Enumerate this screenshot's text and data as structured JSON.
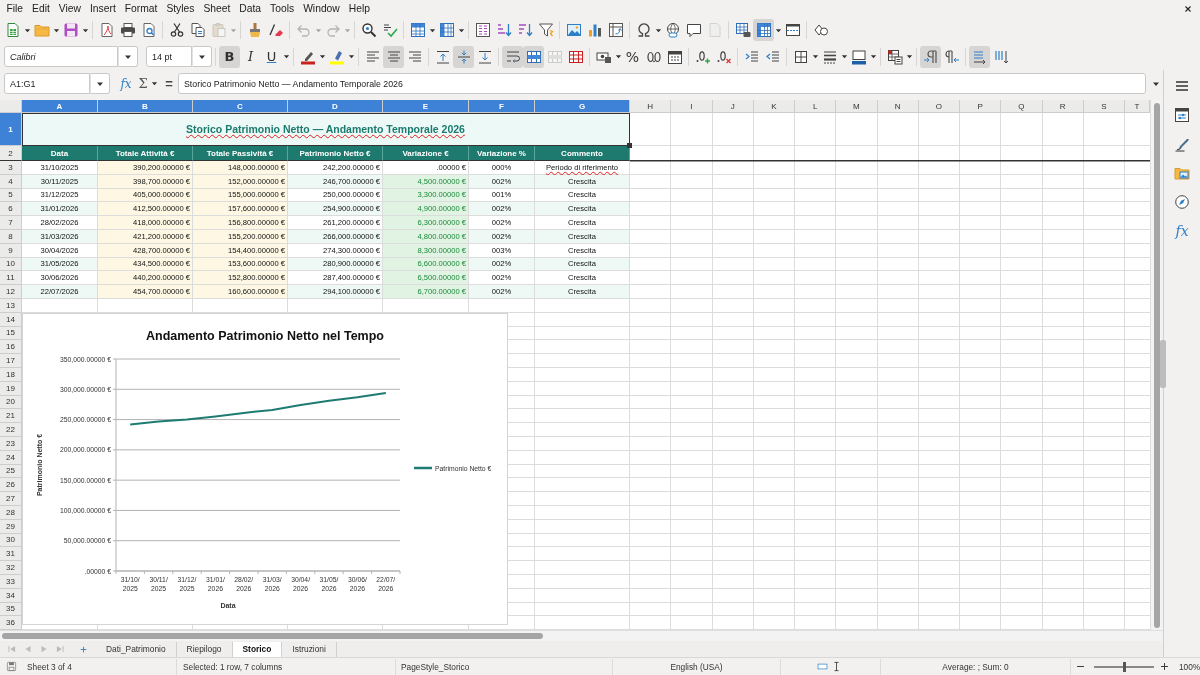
{
  "menu_bar": {
    "items": [
      "File",
      "Edit",
      "View",
      "Insert",
      "Format",
      "Styles",
      "Sheet",
      "Data",
      "Tools",
      "Window",
      "Help"
    ]
  },
  "standard_toolbar": {
    "tools": [
      {
        "pressed": false,
        "disabled": false
      },
      {
        "pressed": false,
        "disabled": false
      },
      {
        "pressed": false,
        "disabled": false
      },
      {
        "pressed": false,
        "disabled": false
      },
      {
        "pressed": false,
        "disabled": false
      },
      {
        "pressed": false,
        "disabled": false
      },
      {
        "pressed": false,
        "disabled": false
      },
      {
        "pressed": false,
        "disabled": false
      },
      {
        "pressed": false,
        "disabled": true
      },
      {
        "pressed": false,
        "disabled": false
      },
      {
        "pressed": false,
        "disabled": false
      },
      {
        "pressed": false,
        "disabled": true
      },
      {
        "pressed": false,
        "disabled": true
      },
      {
        "pressed": false,
        "disabled": false
      },
      {
        "pressed": false,
        "disabled": false
      },
      {
        "pressed": false,
        "disabled": false
      },
      {
        "pressed": false,
        "disabled": false
      },
      {
        "pressed": false,
        "disabled": false
      },
      {
        "pressed": false,
        "disabled": false
      },
      {
        "pressed": false,
        "disabled": false
      },
      {
        "pressed": false,
        "disabled": false
      },
      {
        "pressed": false,
        "disabled": false
      },
      {
        "pressed": false,
        "disabled": false
      },
      {
        "pressed": false,
        "disabled": false
      },
      {
        "pressed": false,
        "disabled": false
      },
      {
        "pressed": false,
        "disabled": false
      },
      {
        "pressed": false,
        "disabled": false
      },
      {
        "pressed": false,
        "disabled": true
      },
      {
        "pressed": false,
        "disabled": false
      },
      {
        "pressed": true,
        "disabled": false
      },
      {
        "pressed": false,
        "disabled": false
      },
      {
        "pressed": false,
        "disabled": false
      }
    ]
  },
  "formatting_toolbar": {
    "font_name": "Calibri",
    "font_size": "14 pt",
    "tools": [
      {
        "label": "B",
        "pressed": true,
        "disabled": false
      },
      {
        "label": "I",
        "pressed": false,
        "disabled": false
      },
      {
        "label": "U",
        "pressed": false,
        "disabled": false
      },
      {
        "pressed": false,
        "disabled": false
      },
      {
        "pressed": false,
        "disabled": false
      },
      {
        "pressed": false,
        "disabled": false
      },
      {
        "pressed": true,
        "disabled": false
      },
      {
        "pressed": false,
        "disabled": false
      },
      {
        "pressed": false,
        "disabled": false
      },
      {
        "pressed": true,
        "disabled": false
      },
      {
        "pressed": false,
        "disabled": false
      },
      {
        "pressed": true,
        "disabled": false
      },
      {
        "pressed": true,
        "disabled": false
      },
      {
        "pressed": false,
        "disabled": true
      },
      {
        "pressed": false,
        "disabled": false
      },
      {
        "pressed": false,
        "disabled": false
      },
      {
        "label": "%",
        "pressed": false,
        "disabled": false
      },
      {
        "pressed": false,
        "disabled": false
      },
      {
        "pressed": false,
        "disabled": false
      },
      {
        "pressed": false,
        "disabled": false
      },
      {
        "pressed": false,
        "disabled": false
      },
      {
        "pressed": false,
        "disabled": false
      },
      {
        "pressed": false,
        "disabled": false
      },
      {
        "pressed": false,
        "disabled": false
      },
      {
        "pressed": false,
        "disabled": false
      },
      {
        "pressed": false,
        "disabled": false
      },
      {
        "pressed": false,
        "disabled": false
      },
      {
        "pressed": true,
        "disabled": false
      },
      {
        "pressed": false,
        "disabled": false
      },
      {
        "pressed": true,
        "disabled": false
      },
      {
        "pressed": false,
        "disabled": false
      }
    ]
  },
  "formula_bar": {
    "name_box": "A1:G1",
    "function_wizard": "fx",
    "sum": "Σ",
    "formula": "=",
    "content": "Storico Patrimonio Netto — Andamento Temporale 2026"
  },
  "sidebar": {
    "functions": "fx"
  },
  "sheet": {
    "columns": [
      {
        "label": "A",
        "selected": true
      },
      {
        "label": "B",
        "selected": true
      },
      {
        "label": "C",
        "selected": true
      },
      {
        "label": "D",
        "selected": true
      },
      {
        "label": "E",
        "selected": true
      },
      {
        "label": "F",
        "selected": true
      },
      {
        "label": "G",
        "selected": true
      },
      {
        "label": "H",
        "selected": false
      },
      {
        "label": "I",
        "selected": false
      },
      {
        "label": "J",
        "selected": false
      },
      {
        "label": "K",
        "selected": false
      },
      {
        "label": "L",
        "selected": false
      },
      {
        "label": "M",
        "selected": false
      },
      {
        "label": "N",
        "selected": false
      },
      {
        "label": "O",
        "selected": false
      },
      {
        "label": "P",
        "selected": false
      },
      {
        "label": "Q",
        "selected": false
      },
      {
        "label": "R",
        "selected": false
      },
      {
        "label": "S",
        "selected": false
      },
      {
        "label": "T",
        "selected": false
      }
    ],
    "rows": [
      {
        "label": "1",
        "selected": true
      },
      {
        "label": "2",
        "selected": false
      },
      {
        "label": "3",
        "selected": false
      },
      {
        "label": "4",
        "selected": false
      },
      {
        "label": "5",
        "selected": false
      },
      {
        "label": "6",
        "selected": false
      },
      {
        "label": "7",
        "selected": false
      },
      {
        "label": "8",
        "selected": false
      },
      {
        "label": "9",
        "selected": false
      },
      {
        "label": "10",
        "selected": false
      },
      {
        "label": "11",
        "selected": false
      },
      {
        "label": "12",
        "selected": false
      },
      {
        "label": "13",
        "selected": false
      },
      {
        "label": "14",
        "selected": false
      },
      {
        "label": "15",
        "selected": false
      },
      {
        "label": "16",
        "selected": false
      },
      {
        "label": "17",
        "selected": false
      },
      {
        "label": "18",
        "selected": false
      },
      {
        "label": "19",
        "selected": false
      },
      {
        "label": "20",
        "selected": false
      },
      {
        "label": "21",
        "selected": false
      },
      {
        "label": "22",
        "selected": false
      },
      {
        "label": "23",
        "selected": false
      },
      {
        "label": "24",
        "selected": false
      },
      {
        "label": "25",
        "selected": false
      },
      {
        "label": "26",
        "selected": false
      },
      {
        "label": "27",
        "selected": false
      },
      {
        "label": "28",
        "selected": false
      },
      {
        "label": "29",
        "selected": false
      },
      {
        "label": "30",
        "selected": false
      },
      {
        "label": "31",
        "selected": false
      },
      {
        "label": "32",
        "selected": false
      },
      {
        "label": "33",
        "selected": false
      },
      {
        "label": "34",
        "selected": false
      },
      {
        "label": "35",
        "selected": false
      },
      {
        "label": "36",
        "selected": false
      }
    ],
    "title": {
      "text": "Storico Patrimonio Netto — Andamento Temporale 2026",
      "selected": true,
      "misspelled": true
    },
    "headers": [
      "Data",
      "Totale Attività €",
      "Totale Passività €",
      "Patrimonio Netto €",
      "Variazione €",
      "Variazione %",
      "Commento"
    ],
    "records": [
      {
        "cells": [
          "31/10/2025",
          "390,200.00000 €",
          "148,000.00000 €",
          "242,200.00000 €",
          ".00000 €",
          "000%",
          "Periodo di riferimento"
        ],
        "positive": false,
        "comment_misspelled": true
      },
      {
        "cells": [
          "30/11/2025",
          "398,700.00000 €",
          "152,000.00000 €",
          "246,700.00000 €",
          "4,500.00000 €",
          "002%",
          "Crescita"
        ],
        "positive": true,
        "comment_misspelled": false
      },
      {
        "cells": [
          "31/12/2025",
          "405,000.00000 €",
          "155,000.00000 €",
          "250,000.00000 €",
          "3,300.00000 €",
          "001%",
          "Crescita"
        ],
        "positive": true,
        "comment_misspelled": false
      },
      {
        "cells": [
          "31/01/2026",
          "412,500.00000 €",
          "157,600.00000 €",
          "254,900.00000 €",
          "4,900.00000 €",
          "002%",
          "Crescita"
        ],
        "positive": true,
        "comment_misspelled": false
      },
      {
        "cells": [
          "28/02/2026",
          "418,000.00000 €",
          "156,800.00000 €",
          "261,200.00000 €",
          "6,300.00000 €",
          "002%",
          "Crescita"
        ],
        "positive": true,
        "comment_misspelled": false
      },
      {
        "cells": [
          "31/03/2026",
          "421,200.00000 €",
          "155,200.00000 €",
          "266,000.00000 €",
          "4,800.00000 €",
          "002%",
          "Crescita"
        ],
        "positive": true,
        "comment_misspelled": false
      },
      {
        "cells": [
          "30/04/2026",
          "428,700.00000 €",
          "154,400.00000 €",
          "274,300.00000 €",
          "8,300.00000 €",
          "003%",
          "Crescita"
        ],
        "positive": true,
        "comment_misspelled": false
      },
      {
        "cells": [
          "31/05/2026",
          "434,500.00000 €",
          "153,600.00000 €",
          "280,900.00000 €",
          "6,600.00000 €",
          "002%",
          "Crescita"
        ],
        "positive": true,
        "comment_misspelled": false
      },
      {
        "cells": [
          "30/06/2026",
          "440,200.00000 €",
          "152,800.00000 €",
          "287,400.00000 €",
          "6,500.00000 €",
          "002%",
          "Crescita"
        ],
        "positive": true,
        "comment_misspelled": false
      },
      {
        "cells": [
          "22/07/2026",
          "454,700.00000 €",
          "160,600.00000 €",
          "294,100.00000 €",
          "6,700.00000 €",
          "002%",
          "Crescita"
        ],
        "positive": true,
        "comment_misspelled": false
      }
    ],
    "chart": {
      "chart_data": {
        "type": "line",
        "title": "Andamento Patrimonio Netto nel Tempo",
        "xlabel": "Data",
        "ylabel": "Patrimonio Netto €",
        "categories": [
          "31/10/2025",
          "30/11/2025",
          "31/12/2025",
          "31/01/2026",
          "28/02/2026",
          "31/03/2026",
          "30/04/2026",
          "31/05/2026",
          "30/06/2026",
          "22/07/2026"
        ],
        "series": [
          {
            "name": "Patrimonio Netto €",
            "color": "#1e7b72",
            "values": [
              242000,
              247000,
              250000,
              255000,
              261000,
              266000,
              274000,
              281000,
              287000,
              294000
            ]
          }
        ],
        "ylim": [
          0,
          350000
        ],
        "yticks": [
          {
            "value": 0,
            "label": ".00000 €"
          },
          {
            "value": 50000,
            "label": "50,000.00000 €"
          },
          {
            "value": 100000,
            "label": "100,000.00000 €"
          },
          {
            "value": 150000,
            "label": "150,000.00000 €"
          },
          {
            "value": 200000,
            "label": "200,000.00000 €"
          },
          {
            "value": 250000,
            "label": "250,000.00000 €"
          },
          {
            "value": 300000,
            "label": "300,000.00000 €"
          },
          {
            "value": 350000,
            "label": "350,000.00000 €"
          }
        ],
        "grid": true
      }
    }
  },
  "sheet_tabs": [
    {
      "label": "Dati_Patrimonio",
      "selected": false
    },
    {
      "label": "Riepilogo",
      "selected": false
    },
    {
      "label": "Storico",
      "selected": true
    },
    {
      "label": "Istruzioni",
      "selected": false
    }
  ],
  "status_bar": {
    "sheet": "Sheet 3 of 4",
    "selection": "Selected: 1 row, 7 columns",
    "page_style": "PageStyle_Storico",
    "language": "English (USA)",
    "summary": "Average: ; Sum: 0",
    "zoom": {
      "level": 0.5
    },
    "zoom_label": "100%"
  }
}
